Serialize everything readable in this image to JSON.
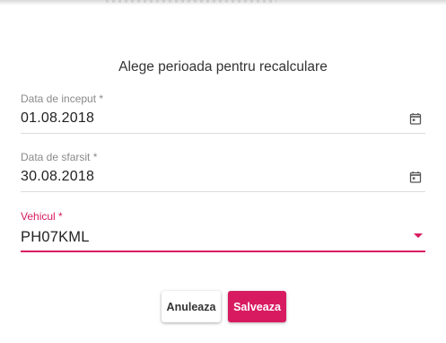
{
  "dialog": {
    "title": "Alege perioada pentru recalculare"
  },
  "fields": {
    "start_date": {
      "label": "Data de inceput *",
      "value": "01.08.2018",
      "icon": "calendar-icon"
    },
    "end_date": {
      "label": "Data de sfarsit *",
      "value": "30.08.2018",
      "icon": "calendar-icon"
    },
    "vehicle": {
      "label": "Vehicul *",
      "value": "PH07KML",
      "icon": "dropdown-arrow-icon"
    }
  },
  "actions": {
    "cancel_label": "Anuleaza",
    "save_label": "Salveaza"
  },
  "colors": {
    "accent": "#d81b60",
    "divider": "#dcdcdc",
    "label": "#8a8a8a"
  }
}
